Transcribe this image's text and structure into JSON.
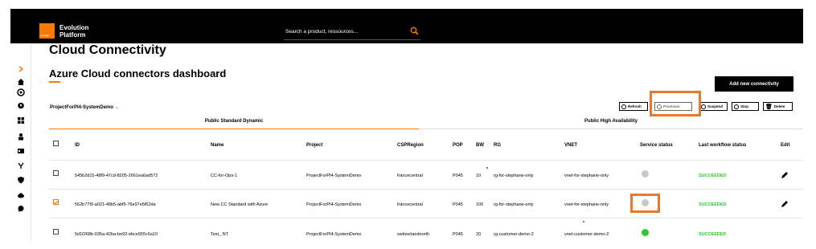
{
  "header": {
    "logo_text": "orange",
    "brand_line1": "Evolution",
    "brand_line2": "Platform",
    "search_placeholder": "Search a product, ressources..."
  },
  "page": {
    "title": "Cloud Connectivity",
    "dashboard_title": "Azure Cloud connectors dashboard",
    "add_button": "Add new connectivity",
    "project_selector": "ProjectForPI4-SystemDemo"
  },
  "actions": {
    "refresh": "Refresh",
    "provision": "Provision",
    "suspend": "Suspend",
    "stop": "Stop",
    "delete": "Delete"
  },
  "tabs": [
    {
      "label": "Public Standard Dynamic"
    },
    {
      "label": "Public High Availability"
    }
  ],
  "table": {
    "columns": [
      "ID",
      "Name",
      "Project",
      "CSPRegion",
      "POP",
      "BW",
      "RG",
      "VNET",
      "Service status",
      "Last workflow status",
      "Edit"
    ],
    "rows": [
      {
        "id": "545b2d15-48f9-47cd-8205-2661ea6ad572",
        "name": "CC-for-Ops-1",
        "project": "ProjectForPI4-SystemDemo",
        "region": "francecentral",
        "pop": "P045",
        "bw": "10",
        "rg": "rg-for-stephane-only",
        "vnet": "vnet-for-stephane-only",
        "service_color": "#c8c8c8",
        "workflow": "SUCCEEDED",
        "checked": false
      },
      {
        "id": "562b77f9-a021-48b5-abf9-76e97e5f62da",
        "name": "New CC Standard with Azure",
        "project": "ProjectForPI4-SystemDemo",
        "region": "francecentral",
        "pop": "P045",
        "bw": "100",
        "rg": "rg-for-stephane-only",
        "vnet": "vnet-for-stephane-only",
        "service_color": "#c8c8c8",
        "workflow": "SUCCEEDED",
        "checked": true
      },
      {
        "id": "5d1f268b-035a-42ba-be92-ebce955c6a10",
        "name": "Test_ NT",
        "project": "ProjectForPI4-SystemDemo",
        "region": "switzerlandnorth",
        "pop": "P045",
        "bw": "20",
        "rg": "rg-customer-demo-2",
        "vnet": "vnet-customer-demo-2",
        "service_color": "#2dc82d",
        "workflow": "SUCCEEDED",
        "checked": false
      }
    ]
  },
  "colors": {
    "accent": "#ff7900",
    "highlight": "#e8782c",
    "success": "#32c832"
  }
}
